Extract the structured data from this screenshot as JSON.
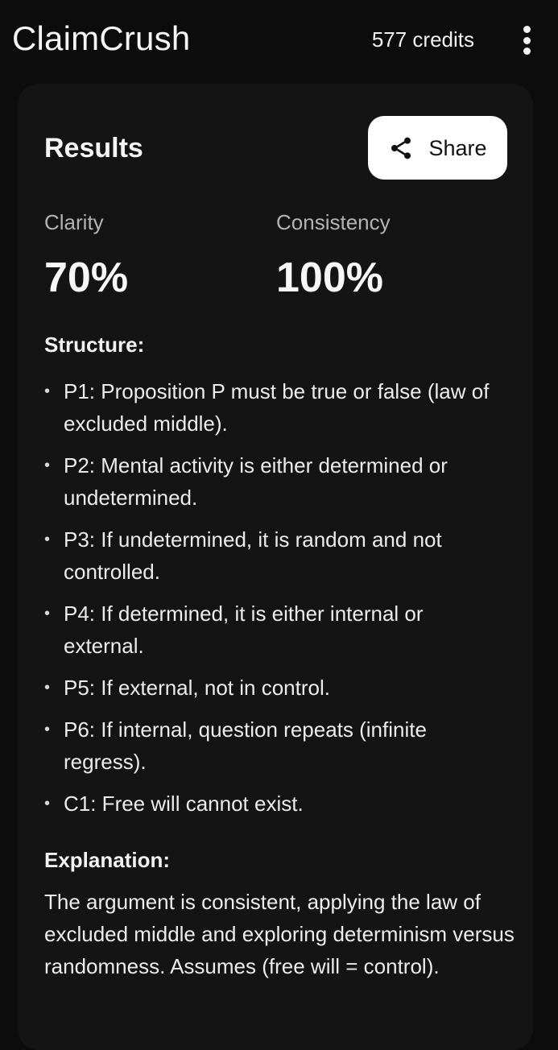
{
  "app_bar": {
    "title": "ClaimCrush",
    "credits": "577 credits",
    "menu_icon": "more-vert-icon"
  },
  "results": {
    "title": "Results",
    "share_label": "Share",
    "share_icon": "share-icon",
    "metrics": [
      {
        "label": "Clarity",
        "value": "70%"
      },
      {
        "label": "Consistency",
        "value": "100%"
      }
    ],
    "structure_heading": "Structure:",
    "structure_items": [
      "P1: Proposition P must be true or false (law of excluded middle).",
      "P2: Mental activity is either determined or undetermined.",
      "P3: If undetermined, it is random and not controlled.",
      "P4: If determined, it is either internal or external.",
      "P5: If external, not in control.",
      "P6: If internal, question repeats (infinite regress).",
      "C1: Free will cannot exist."
    ],
    "explanation_heading": "Explanation:",
    "explanation_text": "The argument is consistent, applying the law of excluded middle and exploring determinism versus randomness. Assumes (free will = control)."
  },
  "colors": {
    "background": "#0c0c0c",
    "card": "#141414",
    "share_button_bg": "#ffffff",
    "text_primary": "#f2f2f2",
    "text_muted": "#b4b4b4"
  }
}
